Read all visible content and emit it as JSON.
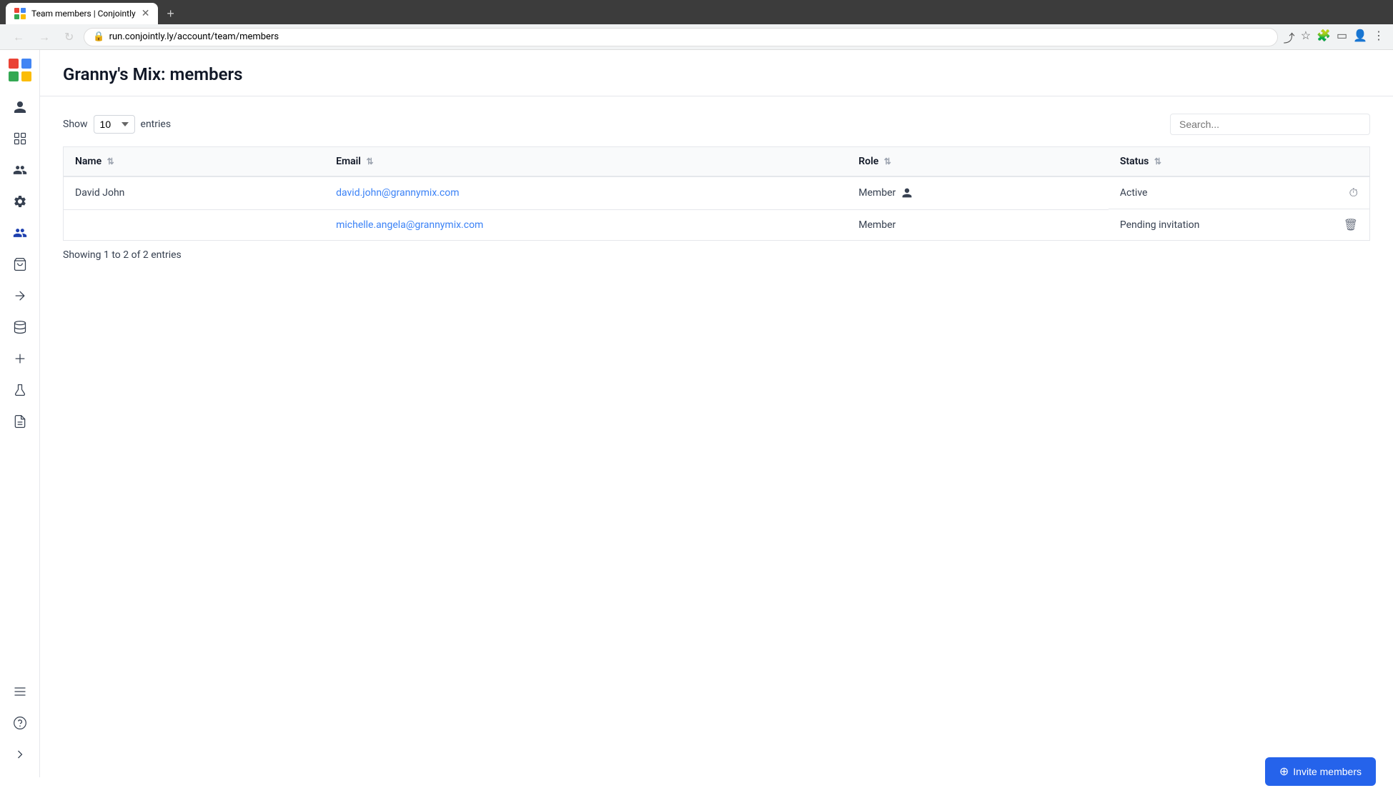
{
  "browser": {
    "tab_title": "Team members | Conjointly",
    "url": "run.conjointly.ly/account/team/members",
    "new_tab_label": "+"
  },
  "page": {
    "title": "Granny's Mix: members"
  },
  "table_controls": {
    "show_label": "Show",
    "entries_label": "entries",
    "entries_value": "10",
    "search_placeholder": "Search..."
  },
  "table": {
    "columns": [
      {
        "id": "name",
        "label": "Name"
      },
      {
        "id": "email",
        "label": "Email"
      },
      {
        "id": "role",
        "label": "Role"
      },
      {
        "id": "status",
        "label": "Status"
      }
    ],
    "rows": [
      {
        "name": "David John",
        "email": "david.john@grannymix.com",
        "role": "Member",
        "status": "Active",
        "has_person_icon": true
      },
      {
        "name": "",
        "email": "michelle.angela@grannymix.com",
        "role": "Member",
        "status": "Pending invitation",
        "has_person_icon": false
      }
    ]
  },
  "showing_text": "Showing 1 to 2 of 2 entries",
  "invite_button_label": "Invite members",
  "sidebar": {
    "items": [
      {
        "id": "person",
        "icon": "person"
      },
      {
        "id": "grid",
        "icon": "grid"
      },
      {
        "id": "users-group",
        "icon": "users-group"
      },
      {
        "id": "settings",
        "icon": "settings"
      },
      {
        "id": "team",
        "icon": "team",
        "active": true
      },
      {
        "id": "cart",
        "icon": "cart"
      },
      {
        "id": "arrow-right",
        "icon": "arrow-right"
      },
      {
        "id": "database",
        "icon": "database"
      },
      {
        "id": "plus",
        "icon": "plus"
      },
      {
        "id": "flask",
        "icon": "flask"
      },
      {
        "id": "document",
        "icon": "document"
      },
      {
        "id": "menu",
        "icon": "menu"
      },
      {
        "id": "help",
        "icon": "help"
      },
      {
        "id": "chevron-right",
        "icon": "chevron-right"
      }
    ]
  }
}
